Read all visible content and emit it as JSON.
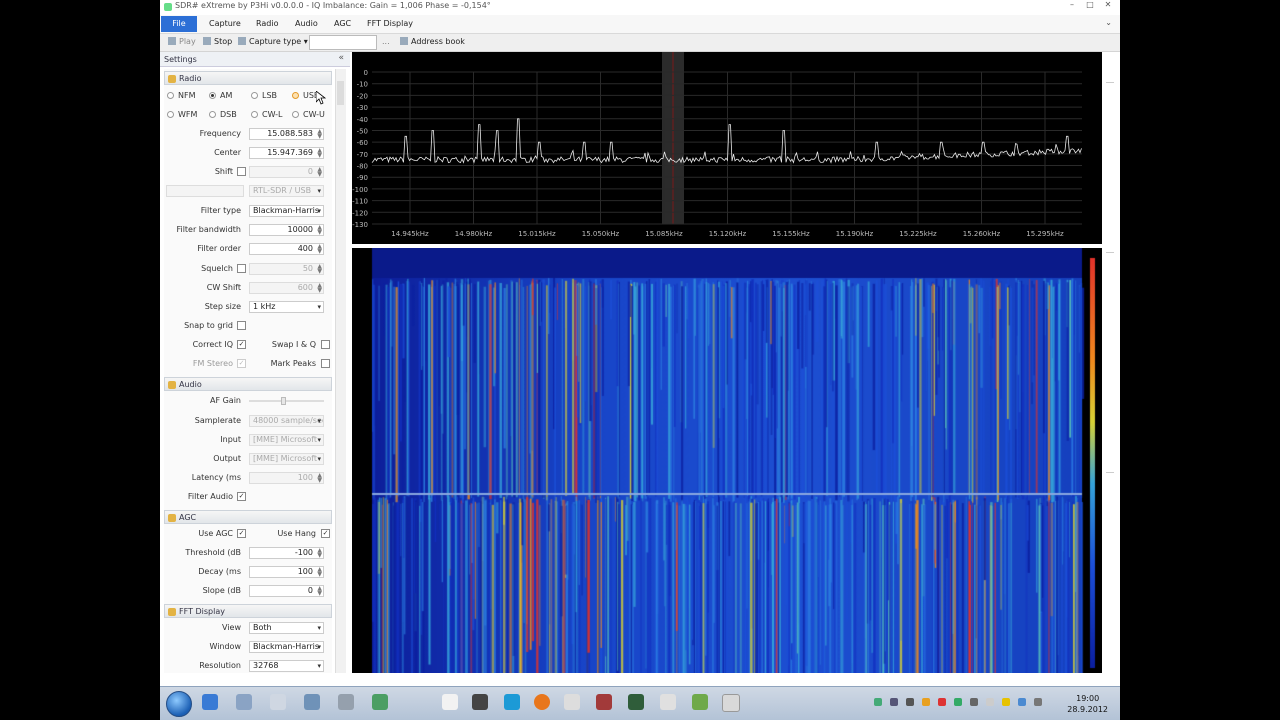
{
  "window": {
    "title": "SDR# eXtreme by P3Hi v0.0.0.0 - IQ Imbalance: Gain = 1,006 Phase = -0,154°",
    "controls": [
      "–",
      "□",
      "✕"
    ]
  },
  "menu": {
    "file": "File",
    "items": [
      "Capture",
      "Radio",
      "Audio",
      "AGC",
      "FFT Display"
    ],
    "help_icon": "chevron-down-icon"
  },
  "toolbar": {
    "play": "Play",
    "stop": "Stop",
    "capture_type": "Capture type",
    "dots": "...",
    "address_book": "Address book"
  },
  "settings": {
    "title": "Settings",
    "collapse": "«"
  },
  "radio": {
    "section": "Radio",
    "modes_row1": [
      "NFM",
      "AM",
      "LSB",
      "USB"
    ],
    "modes_row2": [
      "WFM",
      "DSB",
      "CW-L",
      "CW-U"
    ],
    "selected_mode": "AM",
    "frequency_label": "Frequency",
    "frequency": "15.088.583",
    "center_label": "Center",
    "center": "15.947.369",
    "shift_label": "Shift",
    "shift_value": "0",
    "device": "RTL-SDR / USB",
    "filter_type_label": "Filter type",
    "filter_type": "Blackman-Harris",
    "filter_bandwidth_label": "Filter bandwidth",
    "filter_bandwidth": "10000",
    "filter_order_label": "Filter order",
    "filter_order": "400",
    "squelch_label": "Squelch",
    "squelch_value": "50",
    "cw_shift_label": "CW Shift",
    "cw_shift_value": "600",
    "step_size_label": "Step size",
    "step_size": "1 kHz",
    "snap_label": "Snap to grid",
    "correct_iq_label": "Correct IQ",
    "swap_iq_label": "Swap I & Q",
    "fm_stereo_label": "FM Stereo",
    "mark_peaks_label": "Mark Peaks"
  },
  "audio": {
    "section": "Audio",
    "af_gain_label": "AF Gain",
    "af_gain_level": 0.45,
    "samplerate_label": "Samplerate",
    "samplerate": "48000 sample/sec",
    "input_label": "Input",
    "input": "[MME] Microsoft",
    "output_label": "Output",
    "output": "[MME] Microsoft",
    "latency_label": "Latency (ms",
    "latency": "100",
    "filter_audio_label": "Filter Audio"
  },
  "agc": {
    "section": "AGC",
    "use_agc_label": "Use AGC",
    "use_hang_label": "Use Hang",
    "threshold_label": "Threshold (dB",
    "threshold": "-100",
    "decay_label": "Decay (ms",
    "decay": "100",
    "slope_label": "Slope (dB",
    "slope": "0"
  },
  "fft_display": {
    "section": "FFT Display",
    "view_label": "View",
    "view": "Both",
    "window_label": "Window",
    "window": "Blackman-Harris",
    "resolution_label": "Resolution",
    "resolution": "32768"
  },
  "spectrum": {
    "y_ticks": [
      "0",
      "-10",
      "-20",
      "-30",
      "-40",
      "-50",
      "-60",
      "-70",
      "-80",
      "-90",
      "-100",
      "-110",
      "-120",
      "-130"
    ],
    "x_ticks": [
      "14.945kHz",
      "14.980kHz",
      "15.015kHz",
      "15.050kHz",
      "15.085kHz",
      "15.120kHz",
      "15.155kHz",
      "15.190kHz",
      "15.225kHz",
      "15.260kHz",
      "15.295kHz"
    ]
  },
  "taskbar": {
    "time": "19:00",
    "date": "28.9.2012"
  }
}
